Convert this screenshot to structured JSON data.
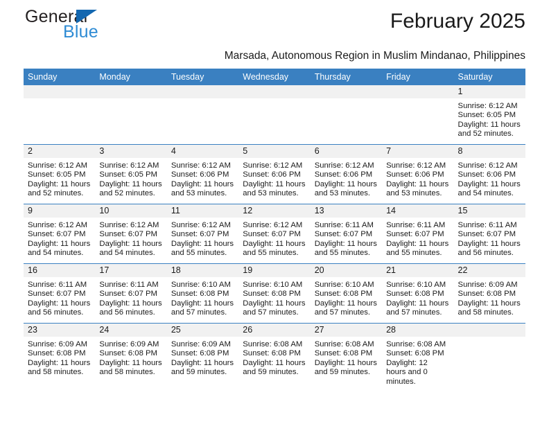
{
  "brand": {
    "name_part1": "General",
    "name_part2": "Blue",
    "triangle_color": "#1367b0",
    "blue_text_color": "#2e8bd4"
  },
  "header": {
    "month_title": "February 2025",
    "subtitle": "Marsada, Autonomous Region in Muslim Mindanao, Philippines",
    "header_bg": "#3a80c1",
    "daynum_bg": "#f1f1f1"
  },
  "weekday_headers": [
    "Sunday",
    "Monday",
    "Tuesday",
    "Wednesday",
    "Thursday",
    "Friday",
    "Saturday"
  ],
  "weeks": [
    [
      {
        "day": "",
        "sunrise": "",
        "sunset": "",
        "daylight": "",
        "empty": true
      },
      {
        "day": "",
        "sunrise": "",
        "sunset": "",
        "daylight": "",
        "empty": true
      },
      {
        "day": "",
        "sunrise": "",
        "sunset": "",
        "daylight": "",
        "empty": true
      },
      {
        "day": "",
        "sunrise": "",
        "sunset": "",
        "daylight": "",
        "empty": true
      },
      {
        "day": "",
        "sunrise": "",
        "sunset": "",
        "daylight": "",
        "empty": true
      },
      {
        "day": "",
        "sunrise": "",
        "sunset": "",
        "daylight": "",
        "empty": true
      },
      {
        "day": "1",
        "sunrise": "Sunrise: 6:12 AM",
        "sunset": "Sunset: 6:05 PM",
        "daylight": "Daylight: 11 hours and 52 minutes.",
        "empty": false
      }
    ],
    [
      {
        "day": "2",
        "sunrise": "Sunrise: 6:12 AM",
        "sunset": "Sunset: 6:05 PM",
        "daylight": "Daylight: 11 hours and 52 minutes.",
        "empty": false
      },
      {
        "day": "3",
        "sunrise": "Sunrise: 6:12 AM",
        "sunset": "Sunset: 6:05 PM",
        "daylight": "Daylight: 11 hours and 52 minutes.",
        "empty": false
      },
      {
        "day": "4",
        "sunrise": "Sunrise: 6:12 AM",
        "sunset": "Sunset: 6:06 PM",
        "daylight": "Daylight: 11 hours and 53 minutes.",
        "empty": false
      },
      {
        "day": "5",
        "sunrise": "Sunrise: 6:12 AM",
        "sunset": "Sunset: 6:06 PM",
        "daylight": "Daylight: 11 hours and 53 minutes.",
        "empty": false
      },
      {
        "day": "6",
        "sunrise": "Sunrise: 6:12 AM",
        "sunset": "Sunset: 6:06 PM",
        "daylight": "Daylight: 11 hours and 53 minutes.",
        "empty": false
      },
      {
        "day": "7",
        "sunrise": "Sunrise: 6:12 AM",
        "sunset": "Sunset: 6:06 PM",
        "daylight": "Daylight: 11 hours and 53 minutes.",
        "empty": false
      },
      {
        "day": "8",
        "sunrise": "Sunrise: 6:12 AM",
        "sunset": "Sunset: 6:06 PM",
        "daylight": "Daylight: 11 hours and 54 minutes.",
        "empty": false
      }
    ],
    [
      {
        "day": "9",
        "sunrise": "Sunrise: 6:12 AM",
        "sunset": "Sunset: 6:07 PM",
        "daylight": "Daylight: 11 hours and 54 minutes.",
        "empty": false
      },
      {
        "day": "10",
        "sunrise": "Sunrise: 6:12 AM",
        "sunset": "Sunset: 6:07 PM",
        "daylight": "Daylight: 11 hours and 54 minutes.",
        "empty": false
      },
      {
        "day": "11",
        "sunrise": "Sunrise: 6:12 AM",
        "sunset": "Sunset: 6:07 PM",
        "daylight": "Daylight: 11 hours and 55 minutes.",
        "empty": false
      },
      {
        "day": "12",
        "sunrise": "Sunrise: 6:12 AM",
        "sunset": "Sunset: 6:07 PM",
        "daylight": "Daylight: 11 hours and 55 minutes.",
        "empty": false
      },
      {
        "day": "13",
        "sunrise": "Sunrise: 6:11 AM",
        "sunset": "Sunset: 6:07 PM",
        "daylight": "Daylight: 11 hours and 55 minutes.",
        "empty": false
      },
      {
        "day": "14",
        "sunrise": "Sunrise: 6:11 AM",
        "sunset": "Sunset: 6:07 PM",
        "daylight": "Daylight: 11 hours and 55 minutes.",
        "empty": false
      },
      {
        "day": "15",
        "sunrise": "Sunrise: 6:11 AM",
        "sunset": "Sunset: 6:07 PM",
        "daylight": "Daylight: 11 hours and 56 minutes.",
        "empty": false
      }
    ],
    [
      {
        "day": "16",
        "sunrise": "Sunrise: 6:11 AM",
        "sunset": "Sunset: 6:07 PM",
        "daylight": "Daylight: 11 hours and 56 minutes.",
        "empty": false
      },
      {
        "day": "17",
        "sunrise": "Sunrise: 6:11 AM",
        "sunset": "Sunset: 6:07 PM",
        "daylight": "Daylight: 11 hours and 56 minutes.",
        "empty": false
      },
      {
        "day": "18",
        "sunrise": "Sunrise: 6:10 AM",
        "sunset": "Sunset: 6:08 PM",
        "daylight": "Daylight: 11 hours and 57 minutes.",
        "empty": false
      },
      {
        "day": "19",
        "sunrise": "Sunrise: 6:10 AM",
        "sunset": "Sunset: 6:08 PM",
        "daylight": "Daylight: 11 hours and 57 minutes.",
        "empty": false
      },
      {
        "day": "20",
        "sunrise": "Sunrise: 6:10 AM",
        "sunset": "Sunset: 6:08 PM",
        "daylight": "Daylight: 11 hours and 57 minutes.",
        "empty": false
      },
      {
        "day": "21",
        "sunrise": "Sunrise: 6:10 AM",
        "sunset": "Sunset: 6:08 PM",
        "daylight": "Daylight: 11 hours and 57 minutes.",
        "empty": false
      },
      {
        "day": "22",
        "sunrise": "Sunrise: 6:09 AM",
        "sunset": "Sunset: 6:08 PM",
        "daylight": "Daylight: 11 hours and 58 minutes.",
        "empty": false
      }
    ],
    [
      {
        "day": "23",
        "sunrise": "Sunrise: 6:09 AM",
        "sunset": "Sunset: 6:08 PM",
        "daylight": "Daylight: 11 hours and 58 minutes.",
        "empty": false
      },
      {
        "day": "24",
        "sunrise": "Sunrise: 6:09 AM",
        "sunset": "Sunset: 6:08 PM",
        "daylight": "Daylight: 11 hours and 58 minutes.",
        "empty": false
      },
      {
        "day": "25",
        "sunrise": "Sunrise: 6:09 AM",
        "sunset": "Sunset: 6:08 PM",
        "daylight": "Daylight: 11 hours and 59 minutes.",
        "empty": false
      },
      {
        "day": "26",
        "sunrise": "Sunrise: 6:08 AM",
        "sunset": "Sunset: 6:08 PM",
        "daylight": "Daylight: 11 hours and 59 minutes.",
        "empty": false
      },
      {
        "day": "27",
        "sunrise": "Sunrise: 6:08 AM",
        "sunset": "Sunset: 6:08 PM",
        "daylight": "Daylight: 11 hours and 59 minutes.",
        "empty": false
      },
      {
        "day": "28",
        "sunrise": "Sunrise: 6:08 AM",
        "sunset": "Sunset: 6:08 PM",
        "daylight": "Daylight: 12 hours and 0 minutes.",
        "empty": false
      },
      {
        "day": "",
        "sunrise": "",
        "sunset": "",
        "daylight": "",
        "empty": true
      }
    ]
  ]
}
